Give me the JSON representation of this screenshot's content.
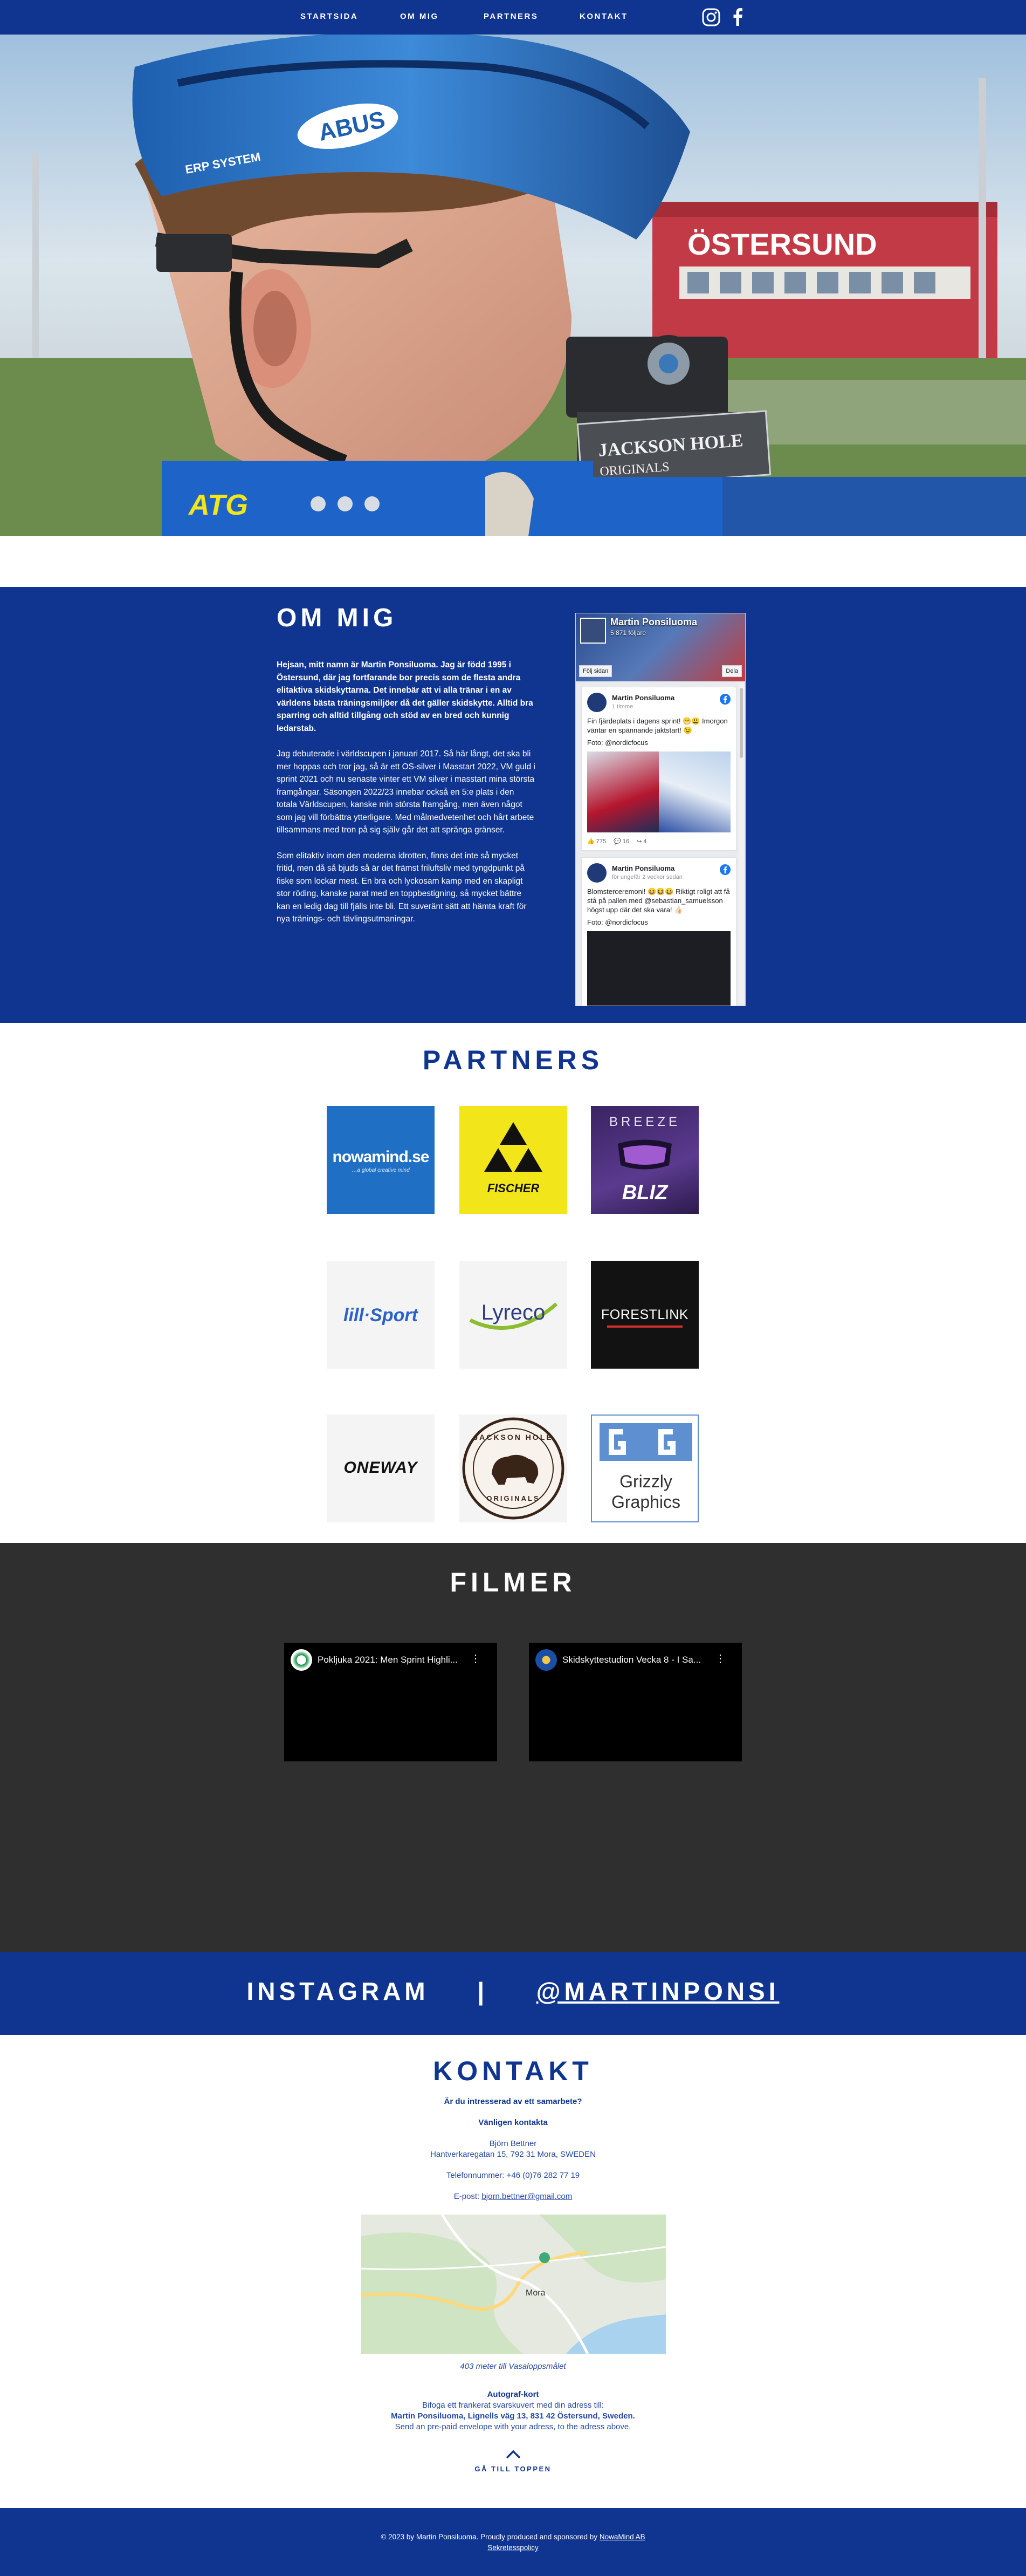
{
  "nav": {
    "items": [
      "STARTSIDA",
      "OM MIG",
      "PARTNERS",
      "KONTAKT"
    ],
    "social": [
      "instagram-icon",
      "facebook-icon"
    ],
    "background": "#0f3591"
  },
  "hero": {
    "helmet_text": "ERP SYSTEM",
    "sign_text": "ÖSTERSUND",
    "plate_line1": "JACKSON HOLE",
    "plate_line2": "ORIGINALS",
    "brand_atg": "ATG",
    "brand_abus": "ABUS"
  },
  "om_mig": {
    "title": "OM MIG",
    "paragraphs": [
      "Hejsan, mitt namn är Martin Ponsiluoma. Jag är född 1995 i Östersund, där jag fortfarande bor precis som de flesta andra elitaktiva skidskyttarna. Det innebär att vi alla tränar i en av världens bästa träningsmiljöer då det gäller skidskytte. Alltid bra sparring och alltid tillgång och stöd av en bred och kunnig ledarstab.",
      "Jag debuterade i världscupen i januari 2017. Så här långt, det ska bli mer hoppas och tror jag, så är ett OS-silver i Masstart 2022, VM guld i sprint 2021 och nu senaste vinter ett VM silver i masstart mina största framgångar. Säsongen 2022/23 innebar också en 5:e plats i den totala Världscupen, kanske min största framgång, men även något som jag vill förbättra ytterligare. Med målmedvetenhet och hårt arbete tillsammans med tron på sig själv går det att spränga gränser.",
      "Som elitaktiv inom den moderna idrotten, finns det inte så mycket fritid, men då så bjuds så är det främst friluftsliv med tyngdpunkt på fiske som lockar mest. En bra och lyckosam kamp med en skapligt stor röding, kanske parat med en toppbestigning, så mycket bättre kan en ledig dag till fjälls inte bli. Ett suveränt sätt att hämta kraft för nya tränings- och tävlingsutmaningar."
    ]
  },
  "facebook_widget": {
    "page_name": "Martin Ponsiluoma",
    "likes": "5 871 följare",
    "like_button": "Följ sidan",
    "share_button": "Dela",
    "posts": [
      {
        "author": "Martin Ponsiluoma",
        "time": "1 timme",
        "text": "Fin fjärdeplats i dagens sprint! 😁😃 Imorgon väntar en spännande jaktstart! 😉",
        "photo_credit": "Foto: @nordicfocus",
        "reactions": "775",
        "comments": "16",
        "shares": "4"
      },
      {
        "author": "Martin Ponsiluoma",
        "time": "för ungefär 2 veckor sedan",
        "text": "Blomsterceremoni! 😆😆😆 Riktigt roligt att få stå på pallen med @sebastian_samuelsson högst upp där det ska vara! 👍🏻",
        "photo_credit": "Foto: @nordicfocus"
      }
    ]
  },
  "partners": {
    "title": "PARTNERS",
    "logos": [
      {
        "name": "nowamind.se",
        "sub": "…a global creative mind",
        "bg": "#1f6fc5"
      },
      {
        "name": "FISCHER",
        "bg": "#f2e51a"
      },
      {
        "name": "BLIZ",
        "top": "BREEZE",
        "bg": "#4a2c79"
      },
      {
        "name": "lill·Sport",
        "bg": "#f4f4f4"
      },
      {
        "name": "Lyreco",
        "bg": "#f4f4f4"
      },
      {
        "name": "FORESTLINK",
        "bg": "#121212"
      },
      {
        "name": "ONEWAY",
        "bg": "#f4f4f4"
      },
      {
        "name": "JACKSON HOLE",
        "sub": "ORIGINALS",
        "bg": "#f4f4f4"
      },
      {
        "name": "Grizzly",
        "sub": "Graphics",
        "bg": "#ffffff"
      }
    ]
  },
  "filmer": {
    "title": "FILMER",
    "videos": [
      {
        "title": "Pokljuka 2021: Men Sprint Highli..."
      },
      {
        "title": "Skidskyttestudion Vecka 8 - I Sa..."
      }
    ]
  },
  "instagram": {
    "label": "INSTAGRAM",
    "separator": "|",
    "handle": "@MARTINPONSI"
  },
  "kontakt": {
    "title": "KONTAKT",
    "question": "Är du intresserad av ett samarbete?",
    "cta": "Vänligen kontakta",
    "name": "Björn Bettner",
    "address": "Hantverkaregatan 15, 792 31 Mora, SWEDEN",
    "phone": "Telefonnummer: +46 (0)76 282 77 19",
    "email_label": "E-post:",
    "email": "bjorn.bettner@gmail.com",
    "map_label_mora": "Mora",
    "map_caption": "403 meter till Vasaloppsmålet",
    "autograph_title": "Autograf-kort",
    "autograph_line1": "Bifoga ett frankerat svarskuvert med din adress till:",
    "autograph_line2": "Martin Ponsiluoma, Lignells väg 13, 831 42 Östersund, Sweden.",
    "autograph_line3": "Send an pre-paid envelope with your adress, to the adress above.",
    "to_top": "GÅ TILL TOPPEN"
  },
  "footer": {
    "text": "© 2023 by Martin Ponsiluoma. Proudly produced and sponsored by",
    "sponsor": "NowaMind AB",
    "policy": "Sekretesspolicy"
  }
}
